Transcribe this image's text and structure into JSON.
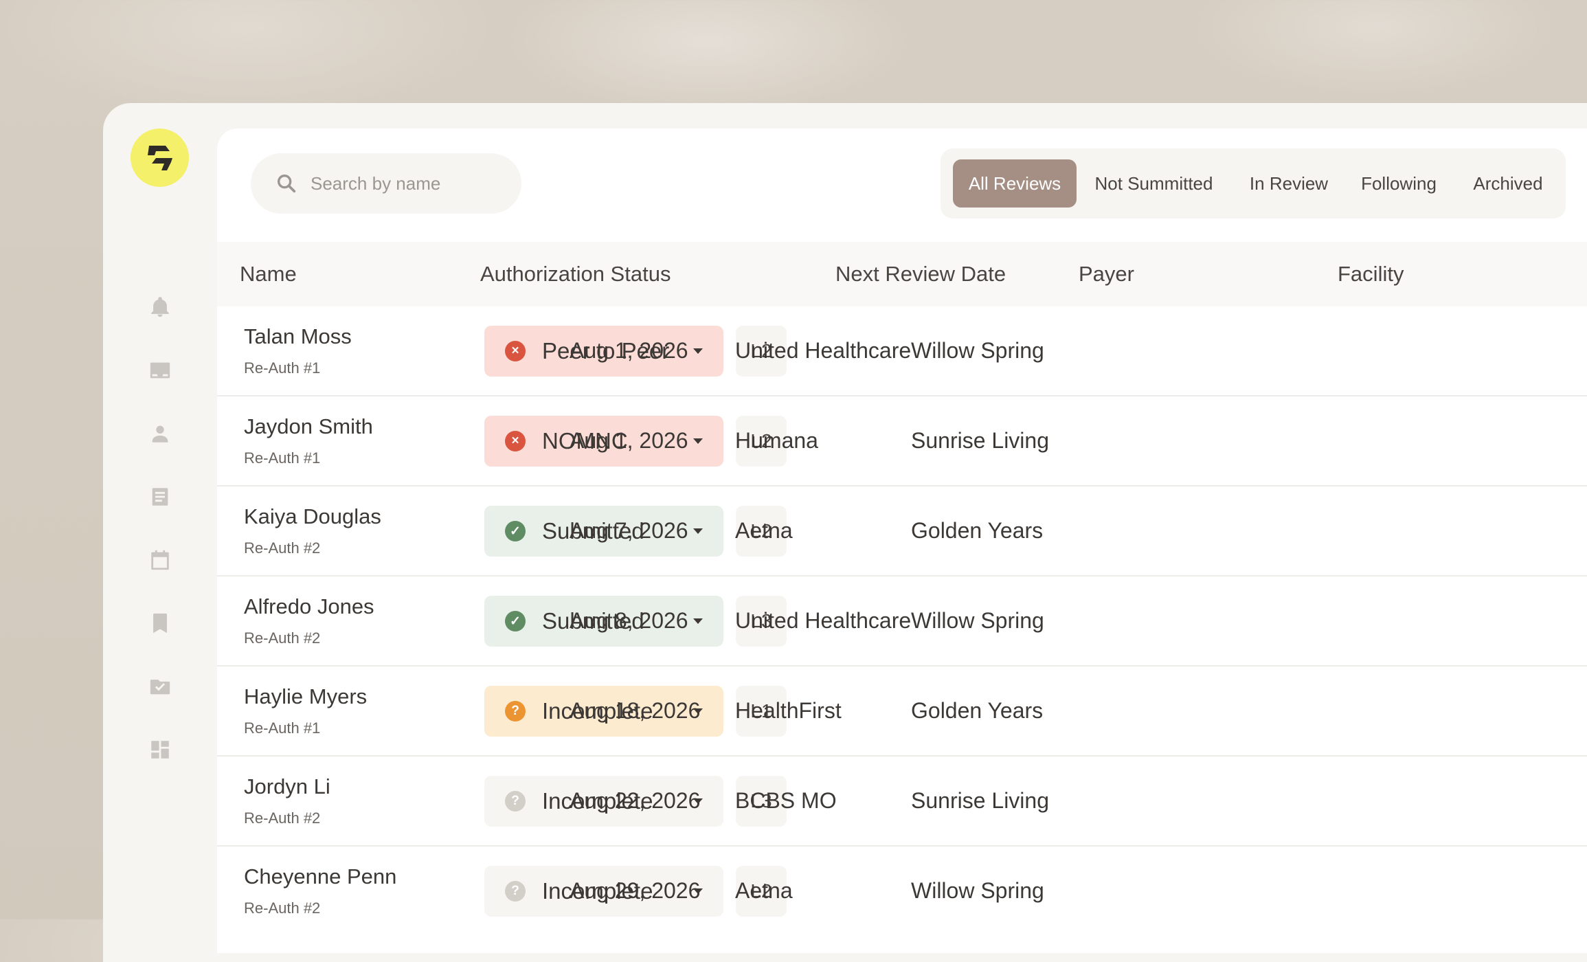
{
  "search": {
    "placeholder": "Search by name"
  },
  "tabs": [
    {
      "label": "All Reviews",
      "active": true
    },
    {
      "label": "Not Summitted",
      "active": false
    },
    {
      "label": "In Review",
      "active": false
    },
    {
      "label": "Following",
      "active": false
    },
    {
      "label": "Archived",
      "active": false
    }
  ],
  "sidebar": {
    "icons": [
      "bell-icon",
      "inbox-check-icon",
      "person-icon",
      "document-icon",
      "calendar-icon",
      "bookmark-icon",
      "folder-check-icon",
      "dashboard-icon"
    ]
  },
  "columns": {
    "name": "Name",
    "status": "Authorization Status",
    "date": "Next Review Date",
    "payer": "Payer",
    "facility": "Facility"
  },
  "rows": [
    {
      "name": "Talan Moss",
      "sub": "Re-Auth #1",
      "status": "Peer to Peer",
      "status_kind": "red",
      "status_icon": "×",
      "level": "L2",
      "date": "Aug 1, 2026",
      "payer": "United Healthcare",
      "facility": "Willow Spring"
    },
    {
      "name": "Jaydon Smith",
      "sub": "Re-Auth #1",
      "status": "NOMNC",
      "status_kind": "red",
      "status_icon": "×",
      "level": "L2",
      "date": "Aug 1, 2026",
      "payer": "Humana",
      "facility": "Sunrise Living"
    },
    {
      "name": "Kaiya Douglas",
      "sub": "Re-Auth #2",
      "status": "Submitted",
      "status_kind": "green",
      "status_icon": "✓",
      "level": "L2",
      "date": "Aug 7, 2026",
      "payer": "Aetna",
      "facility": "Golden Years"
    },
    {
      "name": "Alfredo Jones",
      "sub": "Re-Auth #2",
      "status": "Submitted",
      "status_kind": "green",
      "status_icon": "✓",
      "level": "L3",
      "date": "Aug 8, 2026",
      "payer": "United Healthcare",
      "facility": "Willow Spring"
    },
    {
      "name": "Haylie Myers",
      "sub": "Re-Auth #1",
      "status": "Incomplete",
      "status_kind": "orange",
      "status_icon": "?",
      "level": "L1",
      "date": "Aug 18, 2026",
      "payer": "HealthFirst",
      "facility": "Golden Years"
    },
    {
      "name": "Jordyn Li",
      "sub": "Re-Auth #2",
      "status": "Incomplete",
      "status_kind": "gray",
      "status_icon": "?",
      "level": "L3",
      "date": "Aug 22, 2026",
      "payer": "BCBS MO",
      "facility": "Sunrise Living"
    },
    {
      "name": "Cheyenne Penn",
      "sub": "Re-Auth #2",
      "status": "Incomplete",
      "status_kind": "gray",
      "status_icon": "?",
      "level": "L2",
      "date": "Aug 29, 2026",
      "payer": "Aetna",
      "facility": "Willow Spring"
    }
  ]
}
